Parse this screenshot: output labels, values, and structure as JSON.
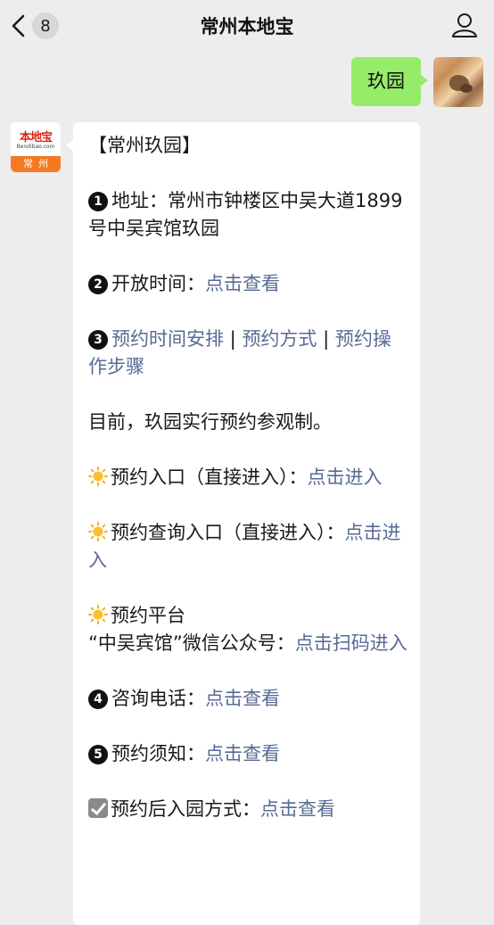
{
  "header": {
    "title": "常州本地宝",
    "unread_count": "8"
  },
  "outgoing": {
    "text": "玖园"
  },
  "official_avatar": {
    "brand": "本地宝",
    "url": "Bendibao.com",
    "city": "常州"
  },
  "message": {
    "title": "【常州玖园】",
    "address_label": "地址：",
    "address_value": "常州市钟楼区中吴大道1899号中吴宾馆玖园",
    "hours_label": "开放时间：",
    "hours_link": "点击查看",
    "schedule_link": "预约时间安排",
    "sep1": " | ",
    "method_link": "预约方式",
    "sep2": " | ",
    "steps_link": "预约操作步骤",
    "notice": "目前，玖园实行预约参观制。",
    "entry_label": "预约入口（直接进入）：",
    "entry_link": "点击进入",
    "query_label": "预约查询入口（直接进入）：",
    "query_link": "点击进入",
    "platform_label": "预约平台",
    "platform_detail": "“中吴宾馆”微信公众号：",
    "platform_link": "点击扫码进入",
    "phone_label": "咨询电话：",
    "phone_link": "点击查看",
    "rules_label": "预约须知：",
    "rules_link": "点击查看",
    "admission_label": "预约后入园方式：",
    "admission_link": "点击查看",
    "numbers": [
      "1",
      "2",
      "3",
      "4",
      "5"
    ]
  },
  "icons": {
    "back": "chevron-left-icon",
    "profile": "user-icon",
    "sun": "sun-icon",
    "check": "checkbox-icon"
  },
  "colors": {
    "bubble_out": "#95ec69",
    "link": "#576b95",
    "background": "#ededed"
  }
}
